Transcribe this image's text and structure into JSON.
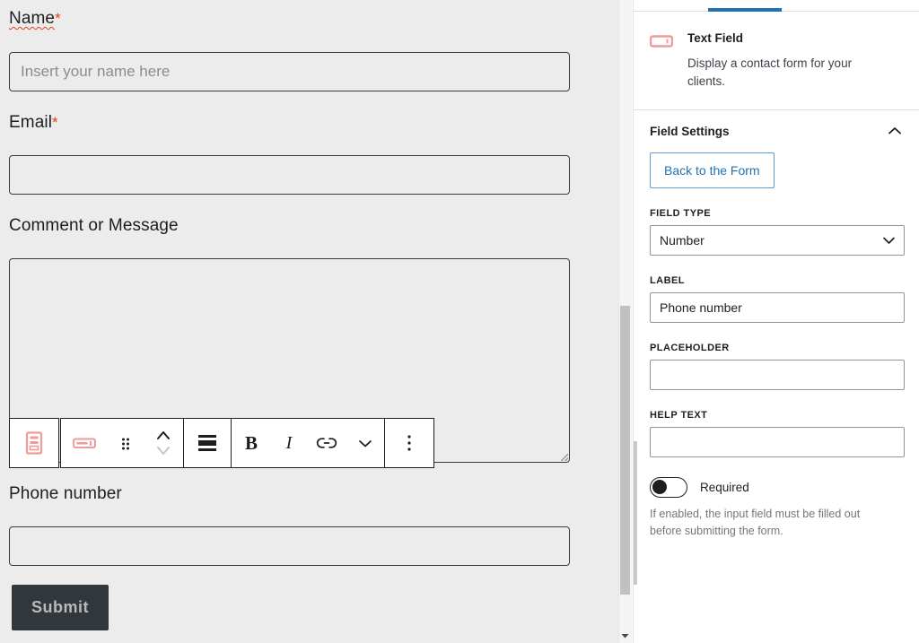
{
  "colors": {
    "canvas_bg": "#ececec",
    "accent_blue": "#2271b1",
    "required_red": "#e2401c",
    "block_icon_pink": "#f19a9a",
    "submit_bg": "#32373c",
    "submit_text": "#b9b9b9"
  },
  "form": {
    "fields": [
      {
        "label": "Name",
        "required_marker": "*",
        "placeholder": "Insert your name here",
        "value": "",
        "type": "text",
        "spellcheck_error": true
      },
      {
        "label": "Email",
        "required_marker": "*",
        "placeholder": "",
        "value": "",
        "type": "text",
        "spellcheck_error": false
      },
      {
        "label": "Comment or Message",
        "required_marker": "",
        "placeholder": "",
        "value": "",
        "type": "textarea",
        "spellcheck_error": false
      },
      {
        "label": "Phone number",
        "required_marker": "",
        "placeholder": "",
        "value": "",
        "type": "text",
        "spellcheck_error": false
      }
    ],
    "submit_label": "Submit"
  },
  "toolbar": {
    "parent_block_icon": "form-block-icon",
    "buttons": [
      {
        "icon": "text-field-block-icon",
        "name": "change-block-type"
      },
      {
        "icon": "drag-handle-icon",
        "name": "drag-block"
      },
      {
        "icon": "move-up-down-icon",
        "name": "move-block"
      },
      {
        "icon": "align-icon",
        "name": "change-alignment"
      },
      {
        "icon": "bold-icon",
        "label": "B",
        "name": "bold"
      },
      {
        "icon": "italic-icon",
        "label": "I",
        "name": "italic"
      },
      {
        "icon": "link-icon",
        "name": "insert-link"
      },
      {
        "icon": "chevron-down-icon",
        "name": "more-rich-text-controls"
      },
      {
        "icon": "kebab-menu-icon",
        "name": "block-options"
      }
    ]
  },
  "sidebar": {
    "active_tab": "Block",
    "block": {
      "icon": "text-field-block-icon",
      "title": "Text Field",
      "description": "Display a contact form for your clients."
    },
    "panel": {
      "title": "Field Settings",
      "collapse_icon": "chevron-up-icon",
      "back_button": "Back to the Form",
      "controls": [
        {
          "label": "FIELD TYPE",
          "kind": "select",
          "value": "Number",
          "icon": "chevron-down-icon"
        },
        {
          "label": "LABEL",
          "kind": "input",
          "value": "Phone number",
          "placeholder": ""
        },
        {
          "label": "PLACEHOLDER",
          "kind": "input",
          "value": "",
          "placeholder": ""
        },
        {
          "label": "HELP TEXT",
          "kind": "input",
          "value": "",
          "placeholder": ""
        }
      ],
      "toggle": {
        "label": "Required",
        "state": "off",
        "help": "If enabled, the input field must be filled out before submitting the form."
      }
    }
  }
}
